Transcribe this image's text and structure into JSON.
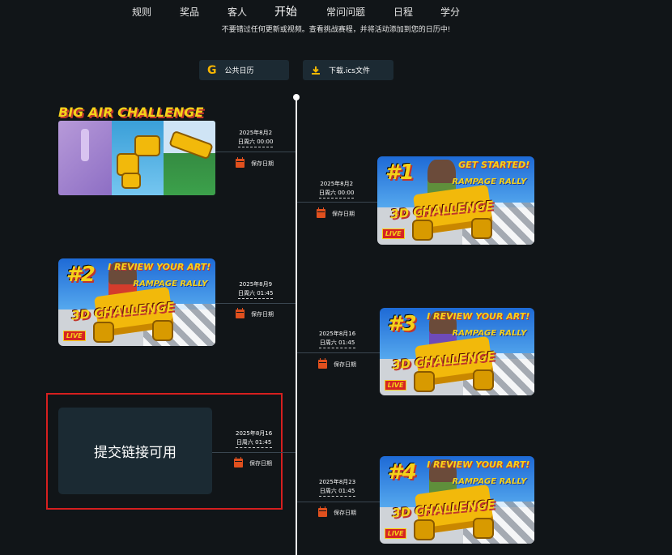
{
  "nav": {
    "items": [
      "规则",
      "奖品",
      "客人",
      "开始",
      "常问问题",
      "日程",
      "学分"
    ],
    "active": "开始"
  },
  "subtitle": "不要错过任何更新或视频。查看挑战赛程，并将活动添加到您的日历中!",
  "buttons": {
    "calendar_label": "公共日历",
    "calendar_icon": "google-g-icon",
    "download_label": "下载.ics文件",
    "download_icon": "download-icon"
  },
  "save_label": "保存日期",
  "events": [
    {
      "date": "2025年8月2",
      "time": "日周六 00:00",
      "title": "BIG AIR CHALLENGE"
    },
    {
      "date": "2025年8月2",
      "time": "日周六 00:00",
      "num": "#1",
      "tag": "GET STARTED!",
      "logo": "RAMPAGE RALLY",
      "big": "3D CHALLENGE",
      "live": "LIVE"
    },
    {
      "date": "2025年8月9",
      "time": "日周六 01:45",
      "num": "#2",
      "tag": "I REVIEW YOUR ART!",
      "logo": "RAMPAGE RALLY",
      "big": "3D CHALLENGE",
      "live": "LIVE"
    },
    {
      "date": "2025年8月16",
      "time": "日周六 01:45",
      "num": "#3",
      "tag": "I REVIEW YOUR ART!",
      "logo": "RAMPAGE RALLY",
      "big": "3D CHALLENGE",
      "live": "LIVE"
    },
    {
      "date": "2025年8月16",
      "time": "日周六 01:45",
      "placeholder": "提交链接可用"
    },
    {
      "date": "2025年8月23",
      "time": "日周六 01:45",
      "num": "#4",
      "tag": "I REVIEW YOUR ART!",
      "logo": "RAMPAGE RALLY",
      "big": "3D CHALLENGE",
      "live": "LIVE"
    }
  ],
  "colors": {
    "accent": "#f5d21a",
    "calendar_icon": "#e0501e",
    "highlight_border": "#d61f1f",
    "card_bg": "#1b2a33"
  }
}
